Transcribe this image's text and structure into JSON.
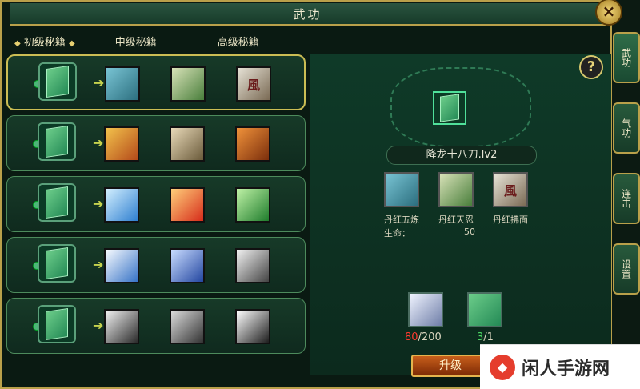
{
  "window": {
    "title": "武功",
    "close_glyph": "×"
  },
  "tabs": [
    {
      "label": "初级秘籍",
      "active": true
    },
    {
      "label": "中级秘籍",
      "active": false
    },
    {
      "label": "高级秘籍",
      "active": false
    }
  ],
  "left_rows": [
    {
      "selected": true,
      "skills": [
        {
          "name": "rock-fist"
        },
        {
          "name": "blade-swirl"
        },
        {
          "name": "feng-scroll"
        }
      ]
    },
    {
      "selected": false,
      "skills": [
        {
          "name": "golden-armor"
        },
        {
          "name": "claw"
        },
        {
          "name": "flame-lion"
        }
      ]
    },
    {
      "selected": false,
      "skills": [
        {
          "name": "ice-wolf"
        },
        {
          "name": "fire-slash"
        },
        {
          "name": "green-vortex"
        }
      ]
    },
    {
      "selected": false,
      "skills": [
        {
          "name": "white-crescent"
        },
        {
          "name": "blue-spin"
        },
        {
          "name": "white-rune"
        }
      ]
    },
    {
      "selected": false,
      "skills": [
        {
          "name": "silver-chain"
        },
        {
          "name": "gray-swords"
        },
        {
          "name": "star-burst"
        }
      ]
    }
  ],
  "right": {
    "help_label": "?",
    "skill_name": "降龙十八刀.lv2",
    "sub_skills": [
      {
        "label": "丹红五炼",
        "icon": "rock-fist"
      },
      {
        "label": "丹红天忍",
        "icon": "blade-swirl"
      },
      {
        "label": "丹红拂面",
        "icon": "feng-scroll",
        "glyph": "風"
      }
    ],
    "stat": {
      "label": "生命：",
      "value": "50"
    },
    "costs": [
      {
        "current": "80",
        "total": "/200",
        "current_color": "#ff3b30"
      },
      {
        "current": "3",
        "total": "/1",
        "current_color": "#4cd964"
      }
    ],
    "upgrade_label": "升级"
  },
  "side_tabs": [
    {
      "label": "武功",
      "selected": true
    },
    {
      "label": "气功",
      "selected": false
    },
    {
      "label": "连击",
      "selected": false
    },
    {
      "label": "设置",
      "selected": false
    }
  ],
  "watermark": {
    "text": "闲人手游网",
    "logo_glyph": "◆"
  },
  "colors": {
    "gold": "#b9a04a",
    "panel": "#0f3a28"
  }
}
